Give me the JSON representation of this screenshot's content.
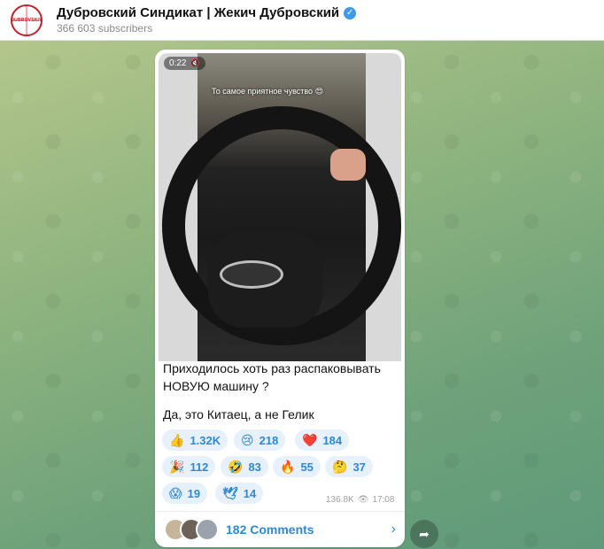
{
  "header": {
    "channel_name": "Дубровский Синдикат | Жекич Дубровский",
    "subscribers": "366 603 subscribers",
    "logo_text": "DUBROVSKIY",
    "verified_icon": "verified-check-icon"
  },
  "post": {
    "video": {
      "duration": "0:22",
      "caption": "То самое приятное чувство 😍"
    },
    "text_lines": [
      "Приходилось хоть раз распаковывать НОВУЮ машину ?",
      "Да, это Китаец, а не Гелик"
    ],
    "reactions": [
      {
        "emoji": "👍",
        "count": "1.32K"
      },
      {
        "emoji": "😢",
        "count": "218"
      },
      {
        "emoji": "❤️",
        "count": "184"
      },
      {
        "emoji": "🎉",
        "count": "112"
      },
      {
        "emoji": "🤣",
        "count": "83"
      },
      {
        "emoji": "🔥",
        "count": "55"
      },
      {
        "emoji": "🤔",
        "count": "37"
      },
      {
        "emoji": "😱",
        "count": "19"
      },
      {
        "emoji": "🕊",
        "count": "14"
      }
    ],
    "views": "136.8K",
    "time": "17:08",
    "comments_label": "182 Comments"
  },
  "colors": {
    "accent": "#2f88d6",
    "reaction_bg": "#e6f1fb",
    "logo_red": "#c8202b"
  }
}
